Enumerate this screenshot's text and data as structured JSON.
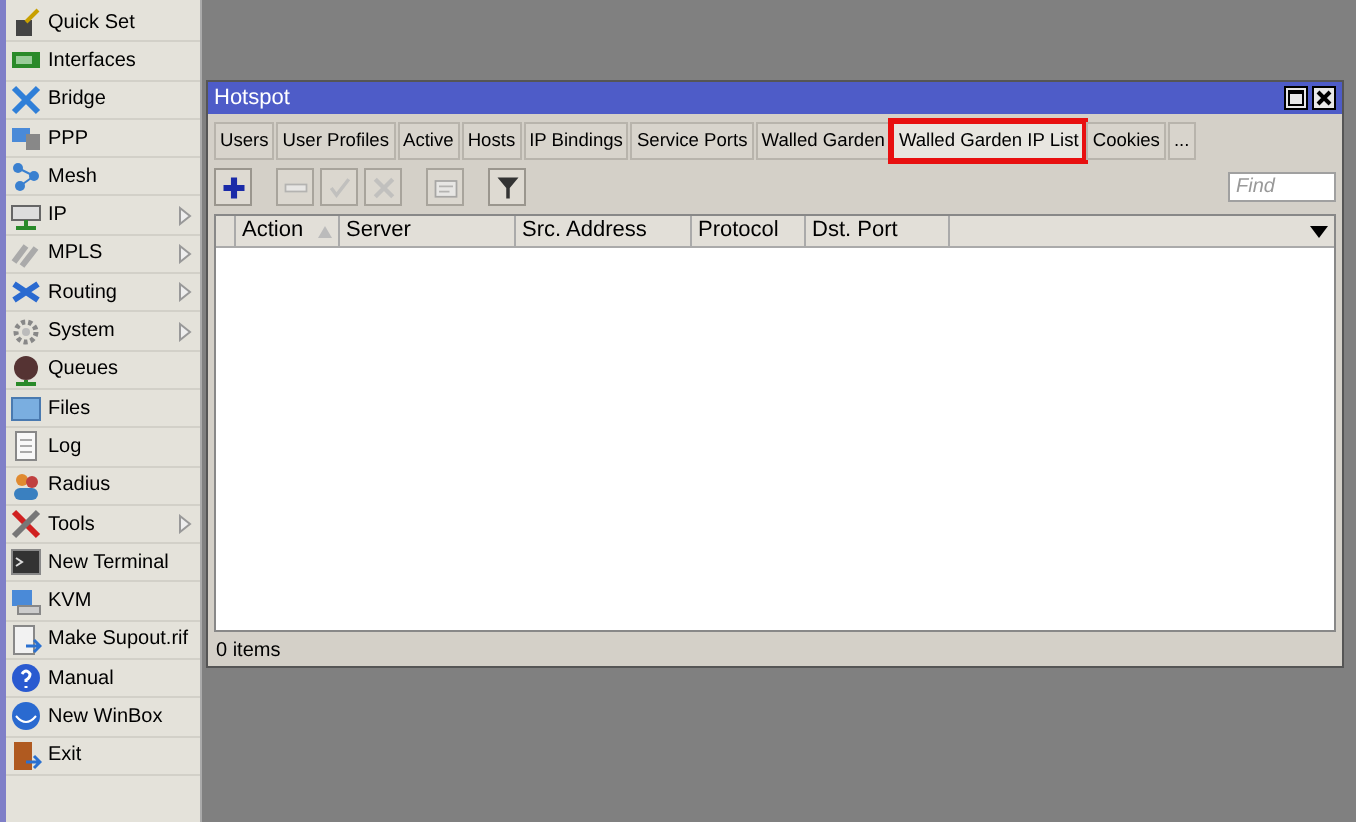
{
  "sidebar": {
    "items": [
      {
        "label": "Quick Set",
        "submenu": false
      },
      {
        "label": "Interfaces",
        "submenu": false
      },
      {
        "label": "Bridge",
        "submenu": false
      },
      {
        "label": "PPP",
        "submenu": false
      },
      {
        "label": "Mesh",
        "submenu": false
      },
      {
        "label": "IP",
        "submenu": true
      },
      {
        "label": "MPLS",
        "submenu": true
      },
      {
        "label": "Routing",
        "submenu": true
      },
      {
        "label": "System",
        "submenu": true
      },
      {
        "label": "Queues",
        "submenu": false
      },
      {
        "label": "Files",
        "submenu": false
      },
      {
        "label": "Log",
        "submenu": false
      },
      {
        "label": "Radius",
        "submenu": false
      },
      {
        "label": "Tools",
        "submenu": true
      },
      {
        "label": "New Terminal",
        "submenu": false
      },
      {
        "label": "KVM",
        "submenu": false
      },
      {
        "label": "Make Supout.rif",
        "submenu": false
      },
      {
        "label": "Manual",
        "submenu": false
      },
      {
        "label": "New WinBox",
        "submenu": false
      },
      {
        "label": "Exit",
        "submenu": false
      }
    ]
  },
  "window": {
    "title": "Hotspot",
    "tabs": [
      {
        "label": "Users",
        "selected": false,
        "highlighted": false
      },
      {
        "label": "User Profiles",
        "selected": false,
        "highlighted": false
      },
      {
        "label": "Active",
        "selected": false,
        "highlighted": false
      },
      {
        "label": "Hosts",
        "selected": false,
        "highlighted": false
      },
      {
        "label": "IP Bindings",
        "selected": false,
        "highlighted": false
      },
      {
        "label": "Service Ports",
        "selected": false,
        "highlighted": false
      },
      {
        "label": "Walled Garden",
        "selected": false,
        "highlighted": false
      },
      {
        "label": "Walled Garden IP List",
        "selected": true,
        "highlighted": true
      },
      {
        "label": "Cookies",
        "selected": false,
        "highlighted": false
      },
      {
        "label": "...",
        "selected": false,
        "highlighted": false
      }
    ],
    "toolbar": [
      {
        "kind": "add",
        "disabled": false
      },
      {
        "kind": "remove",
        "disabled": true
      },
      {
        "kind": "enable",
        "disabled": true
      },
      {
        "kind": "disable",
        "disabled": true
      },
      {
        "kind": "comment",
        "disabled": true
      },
      {
        "kind": "filter",
        "disabled": false
      }
    ],
    "find": {
      "placeholder": "Find"
    },
    "table": {
      "columns": [
        {
          "label": "Action",
          "sorted": true
        },
        {
          "label": "Server",
          "sorted": false
        },
        {
          "label": "Src. Address",
          "sorted": false
        },
        {
          "label": "Protocol",
          "sorted": false
        },
        {
          "label": "Dst. Port",
          "sorted": false
        }
      ]
    },
    "status_bar": "0 items"
  }
}
